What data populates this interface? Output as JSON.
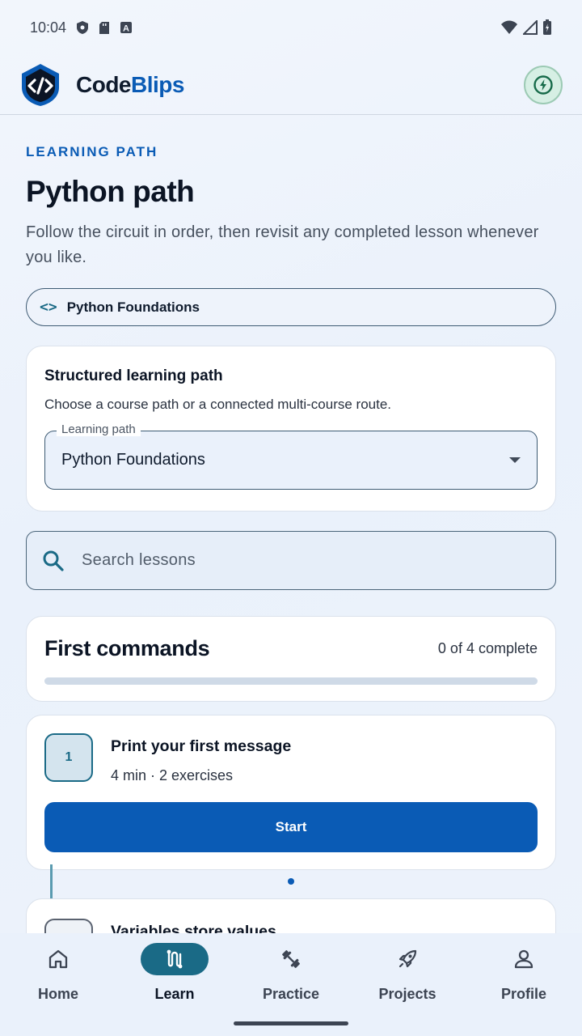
{
  "status_bar": {
    "time": "10:04",
    "icons_left": [
      "shield-icon",
      "sd-card-icon",
      "a-icon"
    ],
    "icons_right": [
      "wifi-icon",
      "signal-icon",
      "battery-icon"
    ]
  },
  "app_bar": {
    "brand_part1": "Code",
    "brand_part2": "Blips",
    "action_icon": "energy-icon"
  },
  "header": {
    "eyebrow": "LEARNING PATH",
    "title": "Python path",
    "description": "Follow the circuit in order, then revisit any completed lesson whenever you like."
  },
  "chip": {
    "icon": "code-icon",
    "label": "Python Foundations"
  },
  "path_card": {
    "title": "Structured learning path",
    "subtitle": "Choose a course path or a connected multi-course route.",
    "select_legend": "Learning path",
    "select_value": "Python Foundations"
  },
  "search": {
    "placeholder": "Search lessons"
  },
  "section": {
    "title": "First commands",
    "count": "0 of 4 complete",
    "progress": 0
  },
  "lessons": [
    {
      "number": "1",
      "title": "Print your first message",
      "meta": "4 min · 2 exercises",
      "action": "Start"
    },
    {
      "title": "Variables store values"
    }
  ],
  "bottom_nav": {
    "items": [
      {
        "label": "Home",
        "icon": "home-icon"
      },
      {
        "label": "Learn",
        "icon": "learn-route-icon",
        "active": true
      },
      {
        "label": "Practice",
        "icon": "dumbbell-icon"
      },
      {
        "label": "Projects",
        "icon": "rocket-icon"
      },
      {
        "label": "Profile",
        "icon": "person-icon"
      }
    ]
  },
  "colors": {
    "accent": "#0a5bb5",
    "teal": "#1a6a86",
    "background": "#eef3fb"
  }
}
